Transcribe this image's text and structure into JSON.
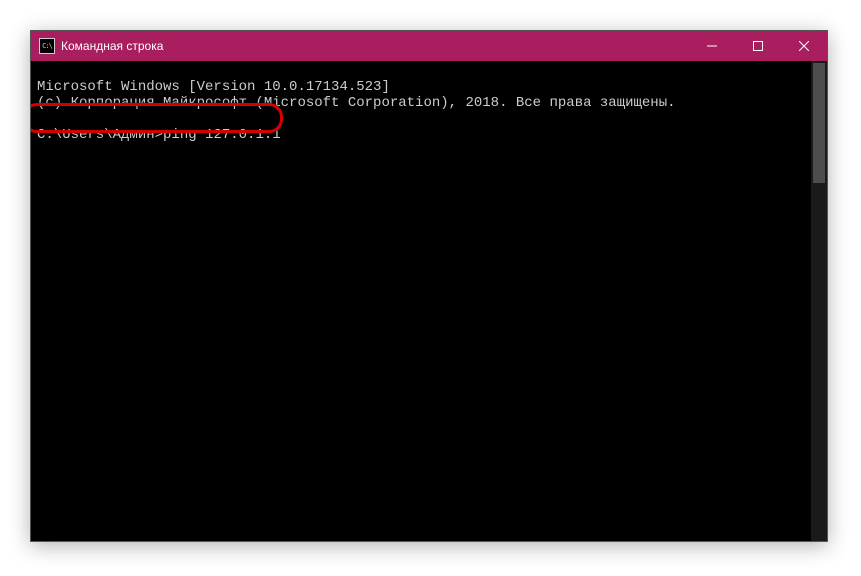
{
  "window": {
    "title": "Командная строка"
  },
  "terminal": {
    "line1": "Microsoft Windows [Version 10.0.17134.523]",
    "line2": "(c) Корпорация Майкрософт (Microsoft Corporation), 2018. Все права защищены.",
    "line3": "",
    "prompt": "C:\\Users\\Админ>",
    "command": "ping 127.0.1.1"
  },
  "annotation": {
    "highlight_target": "command-line"
  }
}
